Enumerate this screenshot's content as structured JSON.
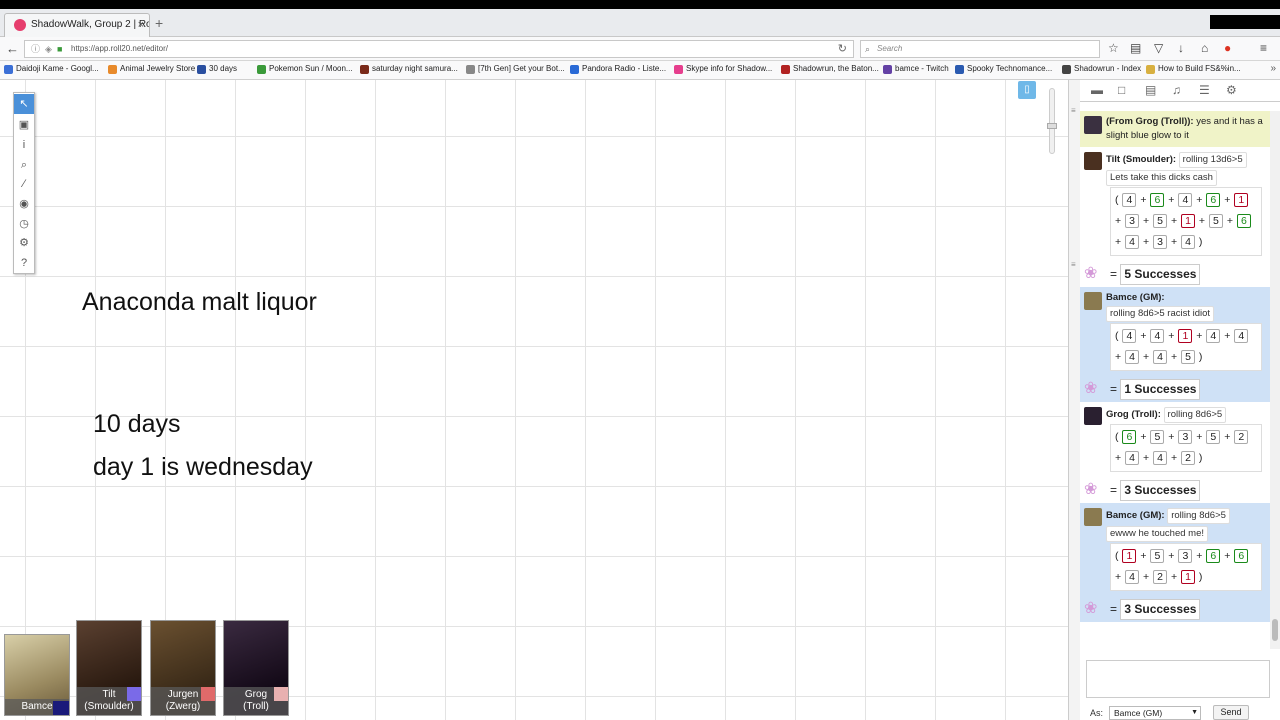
{
  "browser": {
    "tab_title": "ShadowWalk, Group 2 | Rol...",
    "tab_close": "×",
    "new_tab": "+",
    "url": "https://app.roll20.net/editor/",
    "search_placeholder": "Search"
  },
  "bookmarks": [
    {
      "label": "Daidoji Kame - Googl...",
      "color": "#3b6fd6"
    },
    {
      "label": "Animal Jewelry Store ...",
      "color": "#e88a2b"
    },
    {
      "label": "30 days",
      "color": "#2a4fa0"
    },
    {
      "label": "Pokemon Sun / Moon...",
      "color": "#3a9a3a"
    },
    {
      "label": "saturday night samura...",
      "color": "#7a2a1a"
    },
    {
      "label": "[7th Gen] Get your Bot...",
      "color": "#888888"
    },
    {
      "label": "Pandora Radio - Liste...",
      "color": "#2a6ad6"
    },
    {
      "label": "Skype info for Shadow...",
      "color": "#e63e8d"
    },
    {
      "label": "Shadowrun, the Baton...",
      "color": "#b22222"
    },
    {
      "label": "bamce - Twitch",
      "color": "#6441a5"
    },
    {
      "label": "Spooky Technomance...",
      "color": "#2a5ab0"
    },
    {
      "label": "Shadowrun - Index",
      "color": "#444444"
    },
    {
      "label": "How to Build FS&%in...",
      "color": "#d8b040"
    }
  ],
  "canvas": {
    "texts": [
      "Anaconda malt liquor",
      "10 days",
      "day 1 is wednesday"
    ]
  },
  "tools": [
    "select-icon",
    "shapes-icon",
    "info-icon",
    "zoom-icon",
    "ruler-icon",
    "fog-icon",
    "turn-tracker-icon",
    "dice-icon",
    "help-icon"
  ],
  "players": [
    {
      "name": "Bamce",
      "color": "#1a1a7a"
    },
    {
      "name": "Tilt\n(Smoulder)",
      "color": "#7a6ae8"
    },
    {
      "name": "Jurgen\n(Zwerg)",
      "color": "#e06a6a"
    },
    {
      "name": "Grog\n(Troll)",
      "color": "#e8b0b0"
    }
  ],
  "chat": {
    "whisper": {
      "who": "(From Grog (Troll)):",
      "text": "yes and it has a slight blue glow to it"
    },
    "rolls": [
      {
        "who": "Tilt (Smoulder):",
        "cmd": "rolling 13d6>5",
        "note": "Lets take this dicks cash",
        "dice": [
          4,
          6,
          4,
          6,
          1,
          3,
          5,
          1,
          5,
          6,
          4,
          3,
          4
        ],
        "result": "5 Successes",
        "gm": false
      },
      {
        "who": "Bamce (GM):",
        "cmd": "rolling 8d6>5 racist idiot",
        "note": "",
        "dice": [
          4,
          4,
          1,
          4,
          4,
          4,
          4,
          5
        ],
        "result": "1 Successes",
        "gm": true
      },
      {
        "who": "Grog (Troll):",
        "cmd": "rolling 8d6>5",
        "note": "",
        "dice": [
          6,
          5,
          3,
          5,
          2,
          4,
          4,
          2
        ],
        "result": "3 Successes",
        "gm": false
      },
      {
        "who": "Bamce (GM):",
        "cmd": "rolling 8d6>5",
        "note": "ewww he touched me!",
        "dice": [
          1,
          5,
          3,
          6,
          6,
          4,
          2,
          1
        ],
        "result": "3 Successes",
        "gm": true
      }
    ],
    "as_label": "As:",
    "as_value": "Bamce (GM)",
    "send_label": "Send",
    "equals": "="
  }
}
